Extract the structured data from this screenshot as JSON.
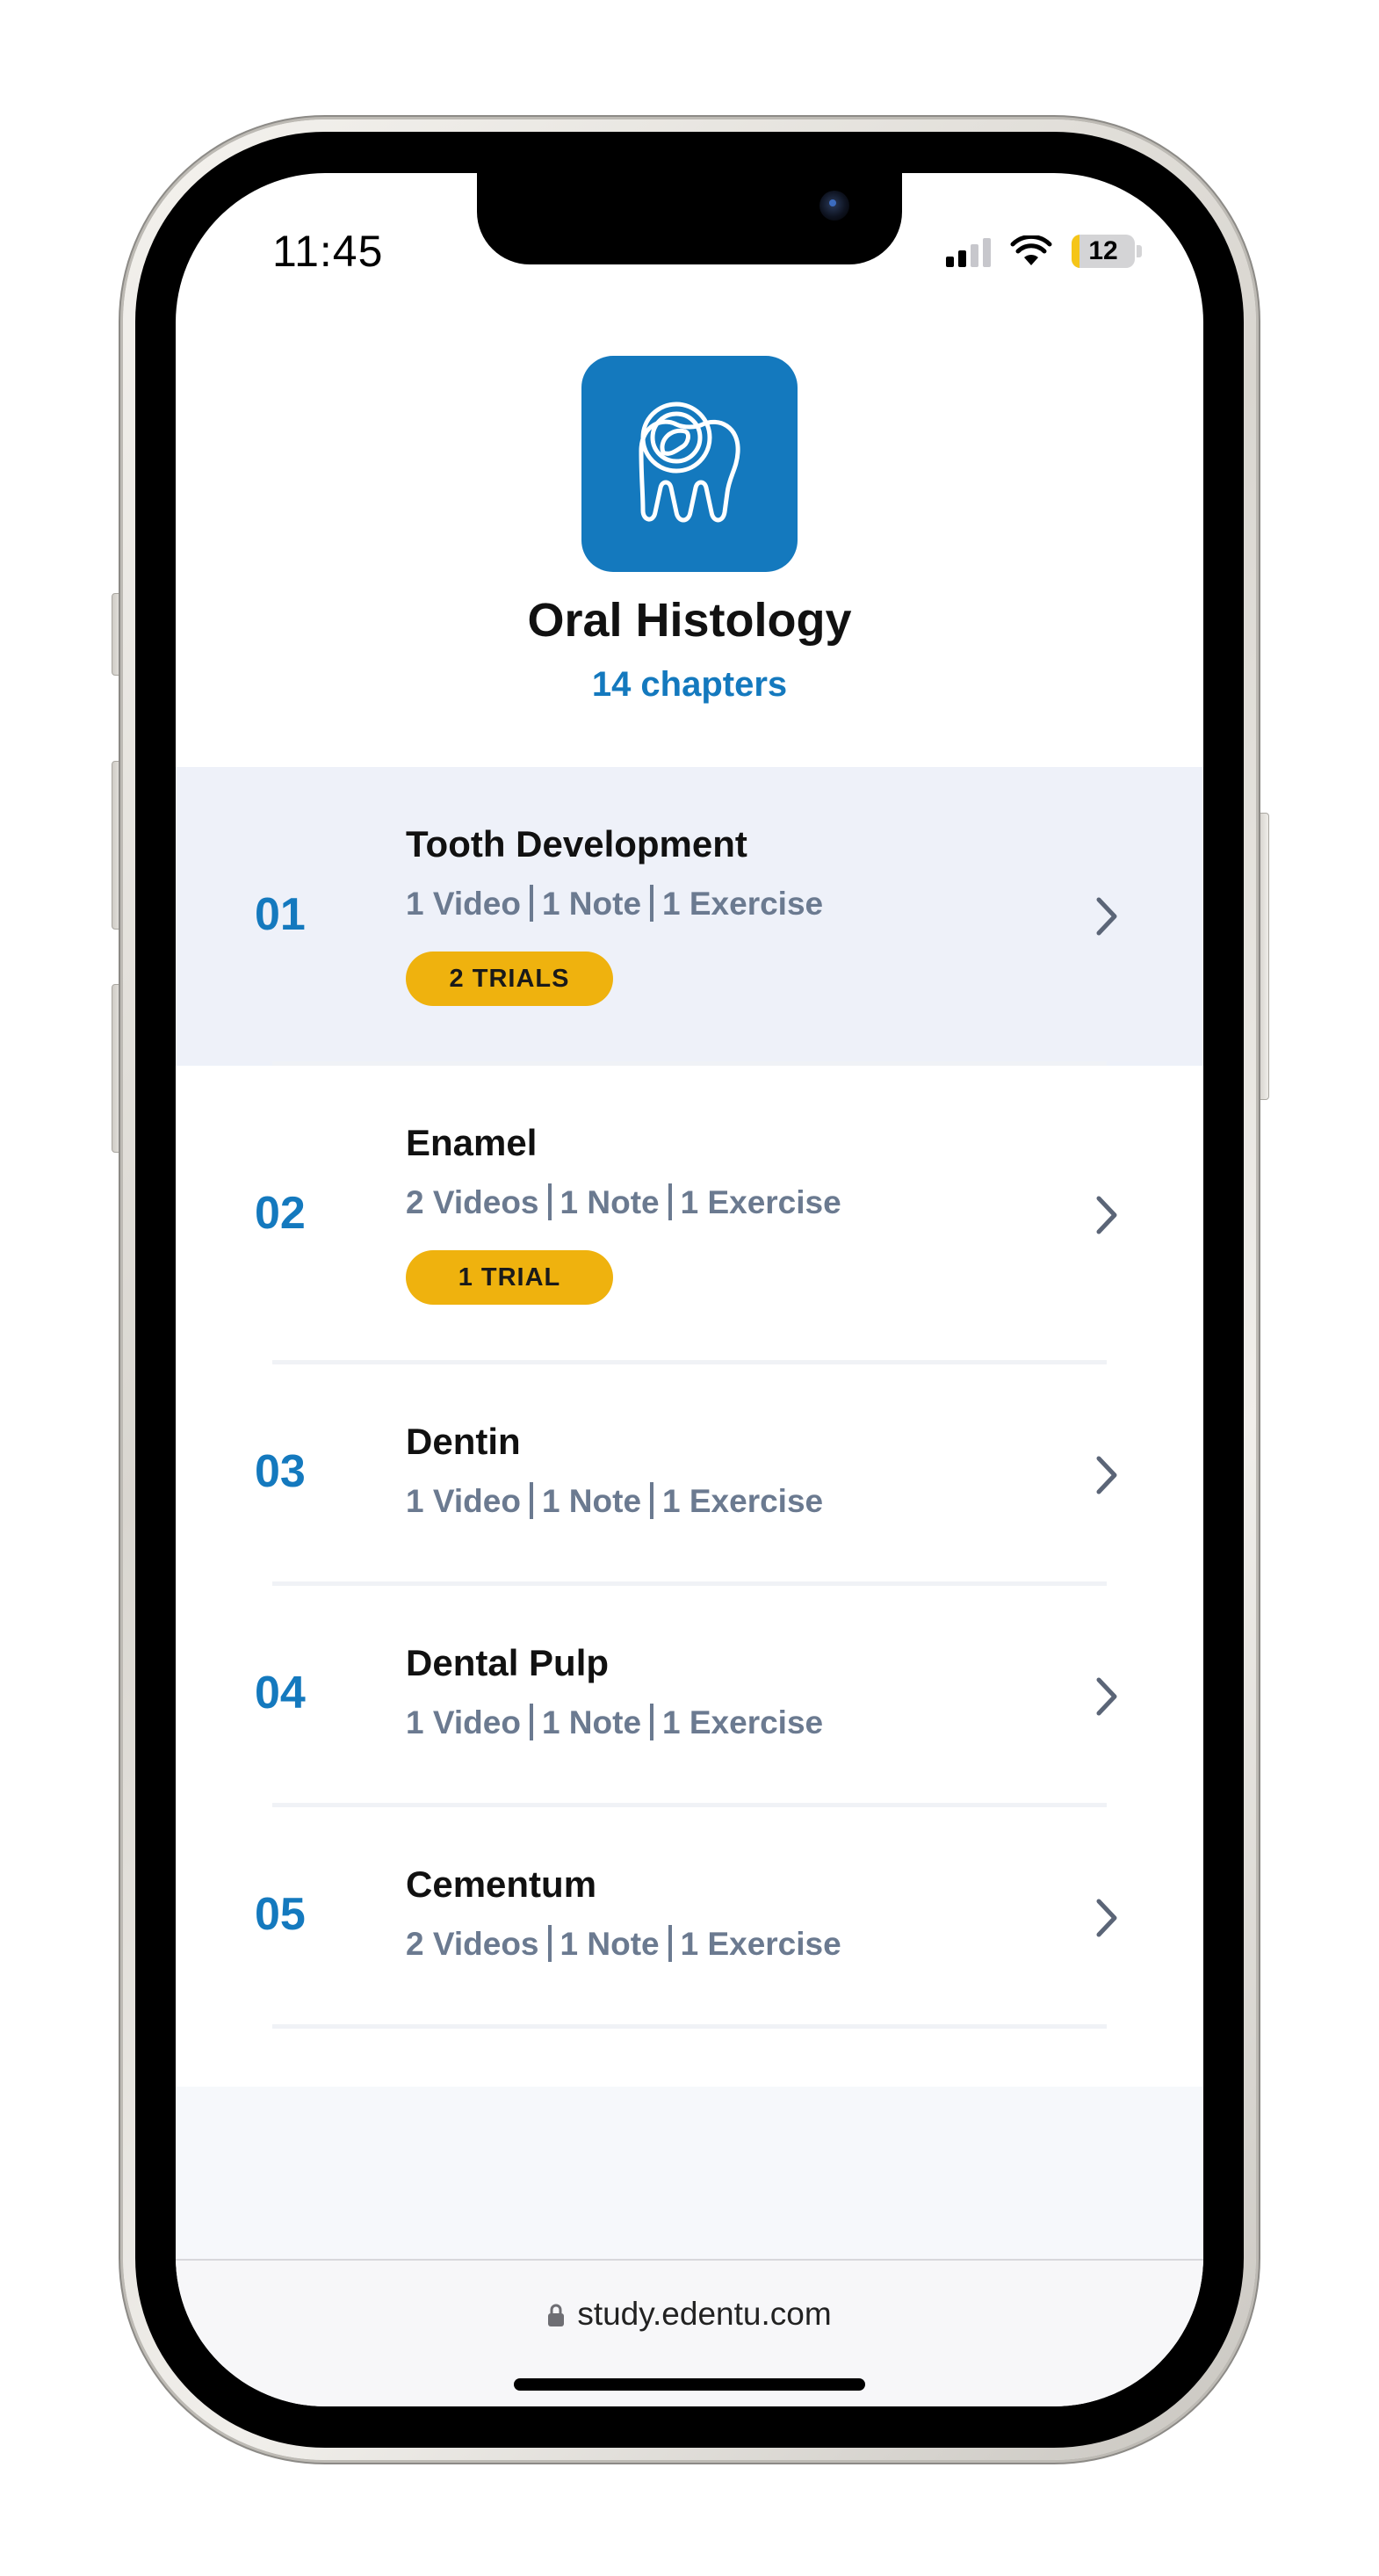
{
  "status_bar": {
    "time": "11:45",
    "battery": "12",
    "battery_level": 0.12,
    "signal_bars": 2,
    "signal_max": 4,
    "icons": [
      "cellular-signal-icon",
      "wifi-icon",
      "battery-icon"
    ]
  },
  "course": {
    "title": "Oral Histology",
    "subtitle": "14 chapters",
    "logo_icon": "tooth-with-magnifier-icon"
  },
  "chapters": [
    {
      "number": "01",
      "title": "Tooth Development",
      "meta": [
        "1 Video",
        "1 Note",
        "1 Exercise"
      ],
      "badge": "2 TRIALS",
      "highlighted": true
    },
    {
      "number": "02",
      "title": "Enamel",
      "meta": [
        "2 Videos",
        "1 Note",
        "1 Exercise"
      ],
      "badge": "1 TRIAL",
      "highlighted": false
    },
    {
      "number": "03",
      "title": "Dentin",
      "meta": [
        "1 Video",
        "1 Note",
        "1 Exercise"
      ],
      "badge": null,
      "highlighted": false
    },
    {
      "number": "04",
      "title": "Dental Pulp",
      "meta": [
        "1 Video",
        "1 Note",
        "1 Exercise"
      ],
      "badge": null,
      "highlighted": false
    },
    {
      "number": "05",
      "title": "Cementum",
      "meta": [
        "2 Videos",
        "1 Note",
        "1 Exercise"
      ],
      "badge": null,
      "highlighted": false
    }
  ],
  "browser": {
    "url": "study.edentu.com",
    "url_icon": "lock-icon"
  },
  "colors": {
    "brand_blue": "#1479be",
    "badge_yellow": "#efb20e",
    "meta_gray": "#6b7a90",
    "highlight_bg": "#eef1f9",
    "battery_yellow": "#f5c518"
  }
}
